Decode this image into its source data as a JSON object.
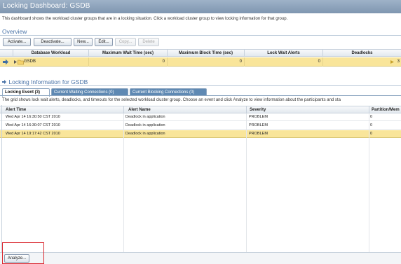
{
  "window": {
    "title": "Locking Dashboard:  GSDB"
  },
  "description": "This dashboard shows the workload cluster groups that are in a locking situation. Click a workload cluster group to view locking information for that group.",
  "overview": {
    "heading": "Overview",
    "toolbar": {
      "activate": "Activate...",
      "deactivate": "Deactivate...",
      "new": "New...",
      "edit": "Edit...",
      "copy": "Copy...",
      "delete": "Delete"
    },
    "columns": [
      "Database Workload",
      "Maximum Wait Time (sec)",
      "Maximum Block Time (sec)",
      "Lock Wait Alerts",
      "Deadlocks"
    ],
    "rows": [
      {
        "name": "GSDB",
        "max_wait": "0",
        "max_block": "0",
        "lock_wait_alerts": "0",
        "deadlocks": "3"
      }
    ]
  },
  "locking": {
    "heading": "Locking Information for GSDB",
    "tabs": [
      "Locking Event (3)",
      "Current Waiting Connections (0)",
      "Current Blocking Connections (0)"
    ],
    "active_tab": 0,
    "grid_description": "The grid shows lock wait alerts, deadlocks, and timeouts for the selected workload cluster group. Choose an event and click Analyze to view information about the participants and sta",
    "columns": [
      "Alert Time",
      "Alert Name",
      "Severity",
      "Partition/Mem"
    ],
    "rows": [
      {
        "time": "Wed Apr 14 16:30:50 CST 2010",
        "name": "Deadlock in application",
        "severity": "PROBLEM",
        "partition": "0"
      },
      {
        "time": "Wed Apr 14 16:30:07 CST 2010",
        "name": "Deadlock in application",
        "severity": "PROBLEM",
        "partition": "0"
      },
      {
        "time": "Wed Apr 14 19:17:42 CST 2010",
        "name": "Deadlock in application",
        "severity": "PROBLEM",
        "partition": "0"
      }
    ],
    "selected_row": 2,
    "analyze": "Analyze..."
  },
  "colors": {
    "title_bar": "#8ea3bc",
    "section_heading": "#4a74a8",
    "selected_row": "#f9e59a",
    "active_tab": "#ffffff",
    "inactive_tab": "#5f89b3",
    "highlight_box": "#d9262e"
  },
  "icons": {
    "row_pointer": "row-arrow-icon",
    "folder": "folder-icon",
    "expand": "expand-icon",
    "section_arrow": "section-arrow-icon"
  }
}
